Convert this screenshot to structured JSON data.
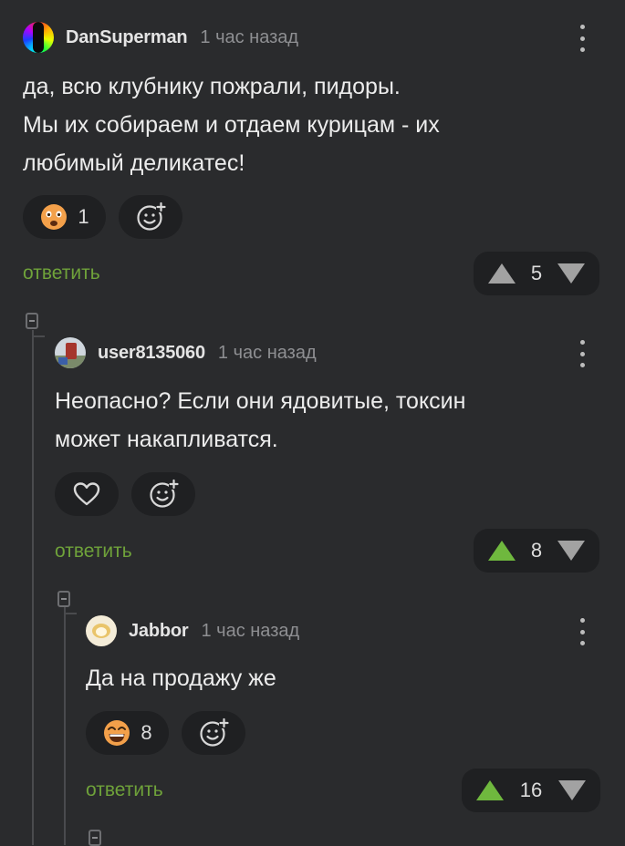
{
  "comments": [
    {
      "author": "DanSuperman",
      "time": "1 час назад",
      "text_lines": [
        "да, всю клубнику пожрали, пидоры.",
        "Мы их собираем и отдаем курицам - их",
        "любимый деликатес!"
      ],
      "reaction_icon": "shocked-face-icon",
      "reaction_count": "1",
      "reply_label": "ответить",
      "score": "5",
      "upvoted": false
    },
    {
      "author": "user8135060",
      "time": "1 час назад",
      "text_lines": [
        "Неопасно? Если они ядовитые, токсин",
        "может накапливатся."
      ],
      "reaction_icon": "heart-icon",
      "reply_label": "ответить",
      "score": "8",
      "upvoted": true
    },
    {
      "author": "Jabbor",
      "time": "1 час назад",
      "text_lines": [
        "Да на продажу же"
      ],
      "reaction_icon": "grinning-face-icon",
      "reaction_count": "8",
      "reply_label": "ответить",
      "score": "16",
      "upvoted": true
    }
  ],
  "colors": {
    "background": "#2a2b2d",
    "pill": "#1f2022",
    "reply_link": "#6fa23a",
    "upvote_active": "#6fb83e"
  }
}
